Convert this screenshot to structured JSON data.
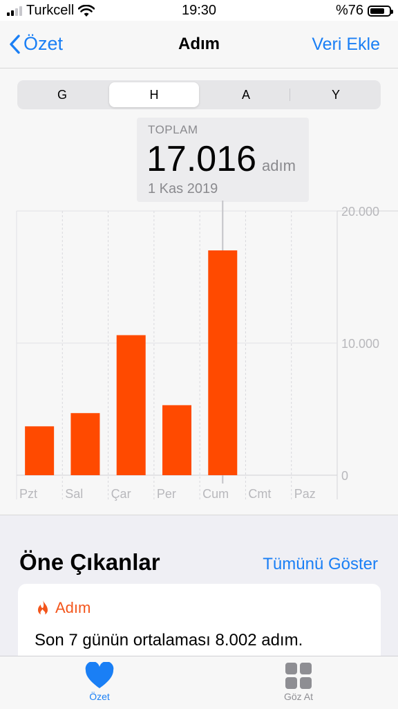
{
  "status": {
    "carrier": "Turkcell",
    "time": "19:30",
    "battery": "%76",
    "battery_level": 0.76
  },
  "nav": {
    "back_label": "Özet",
    "title": "Adım",
    "action_label": "Veri Ekle"
  },
  "segments": [
    "G",
    "H",
    "A",
    "Y"
  ],
  "selected_segment": "H",
  "callout": {
    "label": "TOPLAM",
    "value": "17.016",
    "unit": "adım",
    "date": "1 Kas 2019"
  },
  "chart_data": {
    "type": "bar",
    "categories": [
      "Pzt",
      "Sal",
      "Çar",
      "Per",
      "Cum",
      "Cmt",
      "Paz"
    ],
    "values": [
      3700,
      4700,
      10600,
      5300,
      17016,
      0,
      0
    ],
    "ylim": [
      0,
      20000
    ],
    "yticks": [
      0,
      10000,
      20000
    ],
    "ytick_labels": [
      "0",
      "10.000",
      "20.000"
    ],
    "bar_color": "#ff4a00",
    "highlighted_index": 4,
    "grid": true
  },
  "highlights": {
    "title": "Öne Çıkanlar",
    "show_all": "Tümünü Göster",
    "card": {
      "icon": "flame-icon",
      "label": "Adım",
      "text": "Son 7 günün ortalaması 8.002 adım."
    }
  },
  "tabbar": {
    "summary_label": "Özet",
    "browse_label": "Göz At"
  },
  "colors": {
    "accent": "#1a7ff5",
    "bar": "#ff4a00",
    "highlight_orange": "#f3551b"
  }
}
